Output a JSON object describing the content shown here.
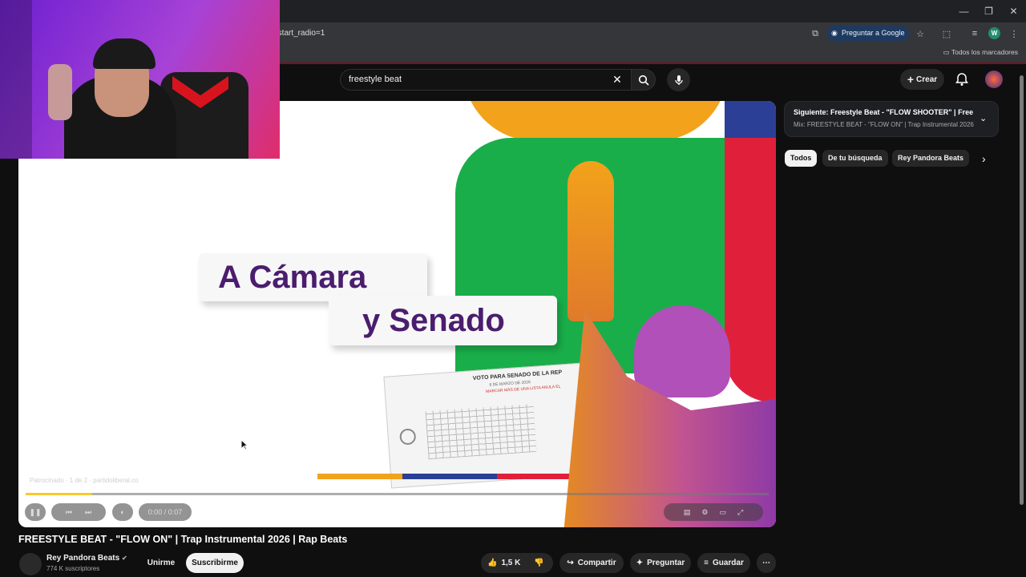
{
  "browser": {
    "url_fragment": "&start_radio=1",
    "ask_google": "Preguntar a Google",
    "bookmarks": "Todos los marcadores",
    "profile_letter": "W",
    "window_controls": [
      "minimize-icon",
      "restore-icon",
      "close-icon"
    ]
  },
  "header": {
    "search_query": "freestyle beat",
    "create_label": "Crear"
  },
  "video": {
    "graphic_line1": "A Cámara",
    "graphic_line2": "y Senado",
    "ballot_title": "VOTO PARA SENADO DE LA REP",
    "ballot_date": "8 DE MARZO DE 2026",
    "ballot_note": "MARCAR MÁS DE UNA LISTA ANULA EL",
    "sponsored_text": "Patrocinado · 1 de 2 · partidoliberal.co",
    "time": "0:00 / 0:07",
    "progress": 0.09
  },
  "sidebar": {
    "next_title": "Siguiente: Freestyle Beat - \"FLOW SHOOTER\" | Free ...",
    "next_subtitle": "Mix: FREESTYLE BEAT - \"FLOW ON\" | Trap Instrumental 2026...",
    "chips": [
      "Todos",
      "De tu búsqueda",
      "Rey Pandora Beats"
    ]
  },
  "below": {
    "title": "FREESTYLE BEAT - \"FLOW ON\" | Trap Instrumental 2026 | Rap Beats",
    "channel": "Rey Pandora Beats",
    "subscribers": "774 K suscriptores",
    "join_label": "Unirme",
    "subscribe_label": "Suscribirme",
    "likes": "1,5 K",
    "share_label": "Compartir",
    "ask_label": "Preguntar",
    "save_label": "Guardar"
  },
  "colors": {
    "accent_red": "#e0203a",
    "purple": "#4a1d6e",
    "green": "#1aae4a",
    "orange": "#f2a21b"
  }
}
